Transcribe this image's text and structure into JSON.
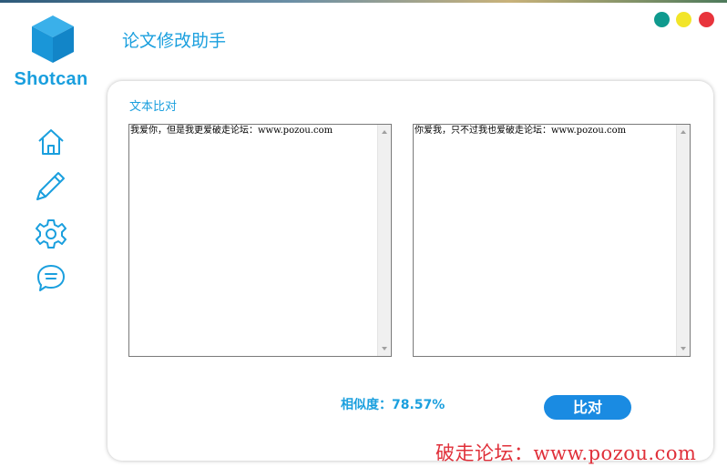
{
  "app": {
    "brand": "Shotcan",
    "title": "论文修改助手"
  },
  "window_controls": [
    "green",
    "yellow",
    "red"
  ],
  "sidebar": {
    "items": [
      {
        "icon": "home-icon"
      },
      {
        "icon": "pencil-icon"
      },
      {
        "icon": "gear-icon"
      },
      {
        "icon": "chat-icon"
      }
    ]
  },
  "compare": {
    "section_label": "文本比对",
    "left_text": "我爱你，但是我更爱破走论坛：www.pozou.com",
    "right_text": "你爱我，只不过我也爱破走论坛：www.pozou.com",
    "similarity_label": "相似度：78.57%",
    "button_label": "比对"
  },
  "watermark": "破走论坛：www.pozou.com",
  "colors": {
    "accent": "#1a9fde",
    "button": "#1a8be2",
    "win_green": "#0f9a8e",
    "win_yellow": "#f2e529",
    "win_red": "#e8343c",
    "watermark": "#e0303a"
  }
}
